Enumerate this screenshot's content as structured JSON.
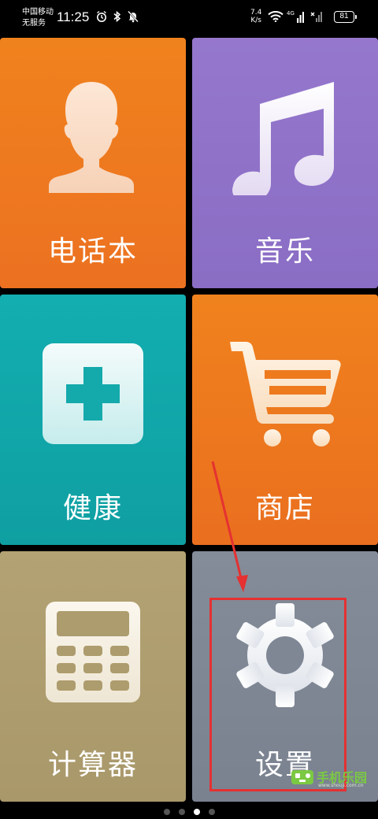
{
  "status_bar": {
    "carrier_line1": "中国移动",
    "carrier_line2": "无服务",
    "time": "11:25",
    "net_speed_value": "7.4",
    "net_speed_unit": "K/s",
    "cell_label": "4G",
    "battery_level": "81"
  },
  "tiles": [
    {
      "label": "电话本",
      "icon": "contact-person-icon",
      "color": "#ef7b1f"
    },
    {
      "label": "音乐",
      "icon": "music-note-icon",
      "color": "#9072c9"
    },
    {
      "label": "健康",
      "icon": "health-plus-icon",
      "color": "#12a8aa"
    },
    {
      "label": "商店",
      "icon": "shopping-cart-icon",
      "color": "#ee7a1e"
    },
    {
      "label": "计算器",
      "icon": "calculator-icon",
      "color": "#af9e6f"
    },
    {
      "label": "设置",
      "icon": "gear-icon",
      "color": "#7f8795"
    }
  ],
  "pager": {
    "count": 4,
    "active_index": 2
  },
  "annotation": {
    "highlight_color": "#e53131"
  },
  "watermark": {
    "text": "手机乐园",
    "url": "www.shouji.com.cn"
  }
}
